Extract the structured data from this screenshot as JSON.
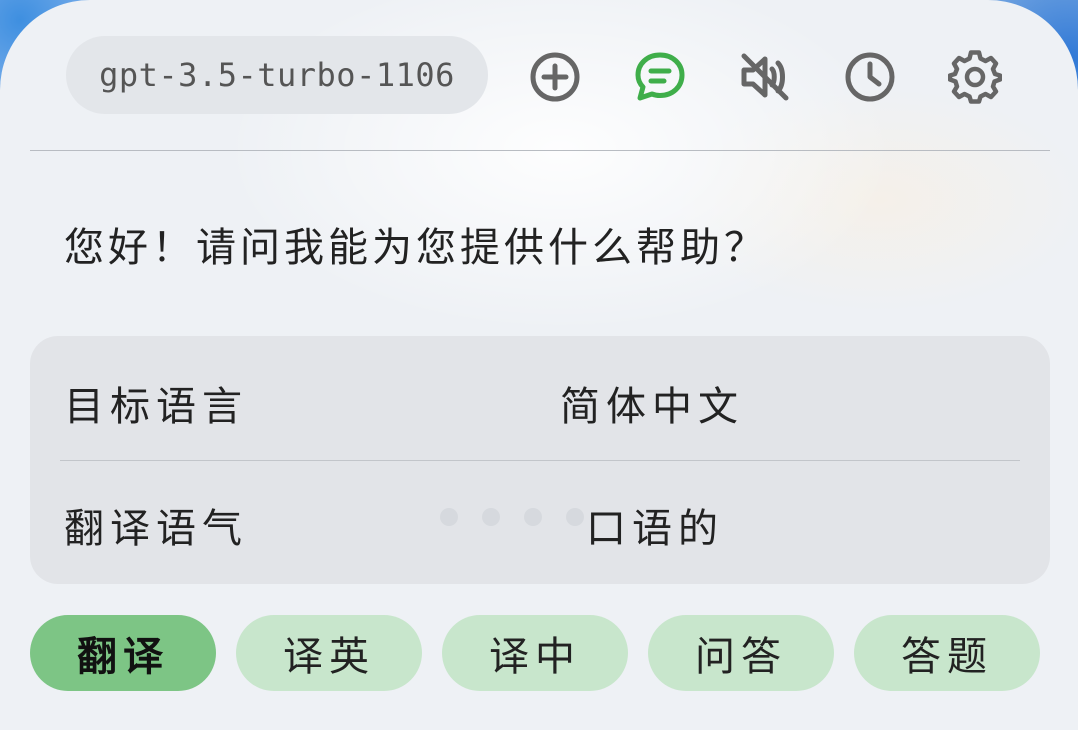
{
  "header": {
    "model": "gpt-3.5-turbo-1106",
    "icons": [
      {
        "name": "add-circle-icon",
        "color": "#666666"
      },
      {
        "name": "chat-bubble-icon",
        "color": "#3fae4a"
      },
      {
        "name": "mute-icon",
        "color": "#666666"
      },
      {
        "name": "history-clock-icon",
        "color": "#666666"
      },
      {
        "name": "settings-gear-icon",
        "color": "#666666"
      }
    ]
  },
  "chat": {
    "greeting": "您好！请问我能为您提供什么帮助？"
  },
  "settings": {
    "rows": [
      {
        "label": "目标语言",
        "value": "简体中文"
      },
      {
        "label": "翻译语气",
        "value": "口语的"
      }
    ]
  },
  "modes": {
    "items": [
      "翻译",
      "译英",
      "译中",
      "问答",
      "答题"
    ],
    "active_index": 0,
    "active_color": "#7dc585",
    "inactive_color": "#c8e6cc"
  }
}
